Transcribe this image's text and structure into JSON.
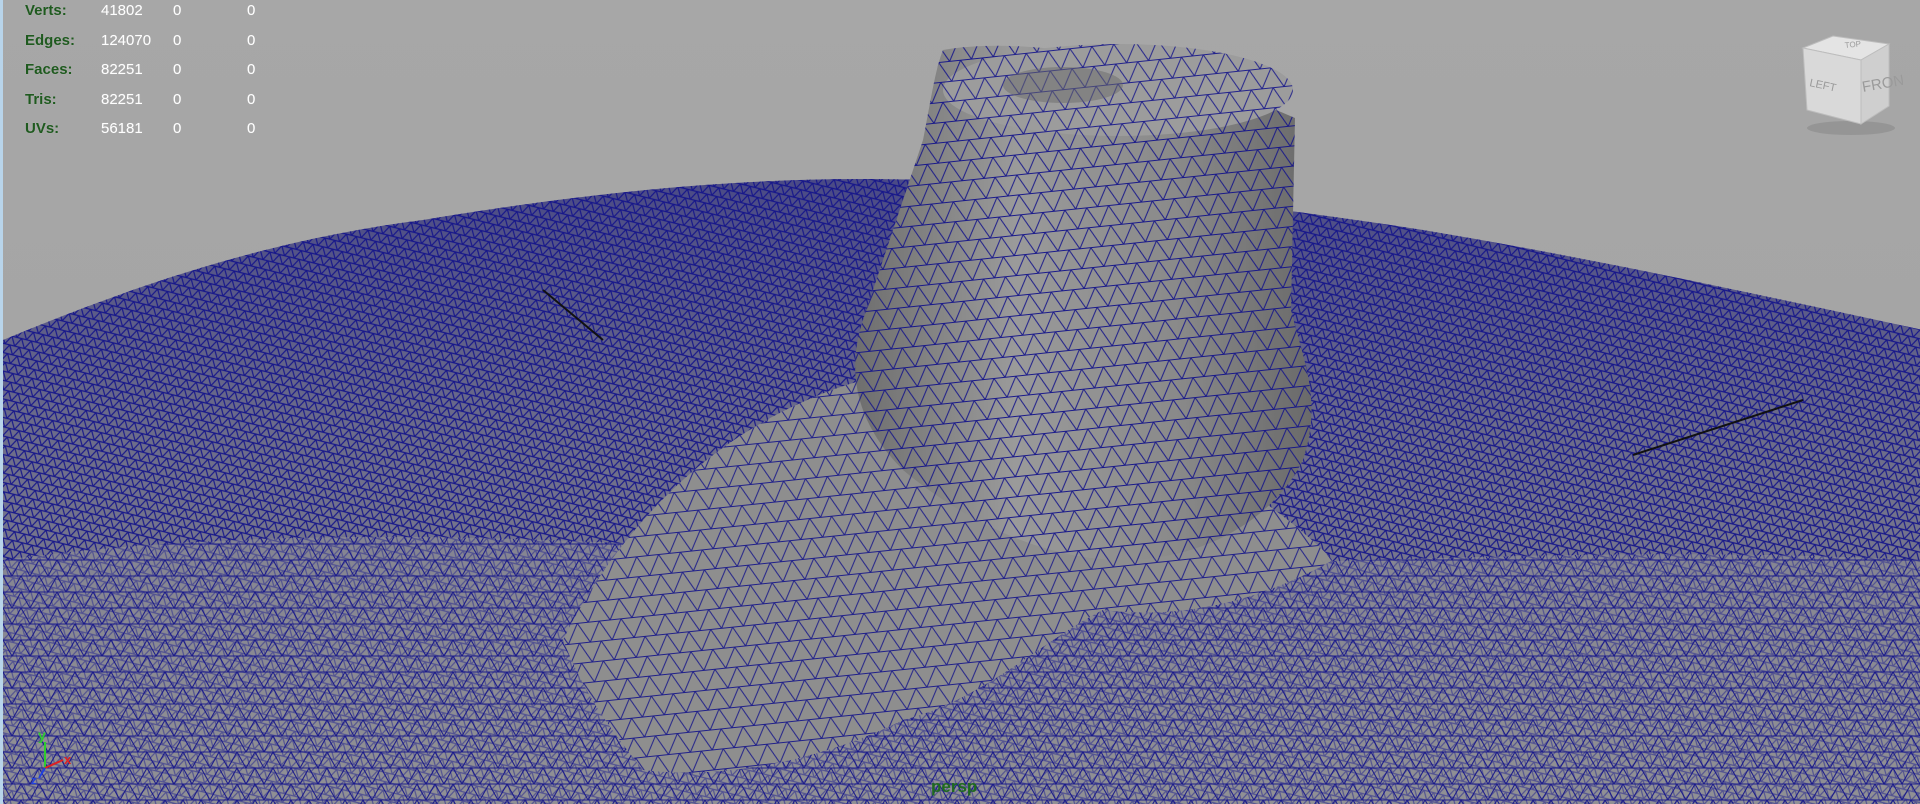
{
  "hud": {
    "rows": [
      {
        "label": "Verts:",
        "v1": "41802",
        "v2": "0",
        "v3": "0"
      },
      {
        "label": "Edges:",
        "v1": "124070",
        "v2": "0",
        "v3": "0"
      },
      {
        "label": "Faces:",
        "v1": "82251",
        "v2": "0",
        "v3": "0"
      },
      {
        "label": "Tris:",
        "v1": "82251",
        "v2": "0",
        "v3": "0"
      },
      {
        "label": "UVs:",
        "v1": "56181",
        "v2": "0",
        "v3": "0"
      }
    ]
  },
  "viewcube": {
    "top_label": "TOP",
    "left_label": "LEFT",
    "front_label": "FRONT"
  },
  "axis": {
    "y_label": "y",
    "x_label": "x",
    "z_label": "z"
  },
  "camera": {
    "name": "persp"
  },
  "colors": {
    "background": "#a4a4a4",
    "mesh_fill": "#8c8c8c",
    "wireframe": "#14148a",
    "hud_label": "#1f5a1f",
    "hud_value": "#ffffff"
  }
}
